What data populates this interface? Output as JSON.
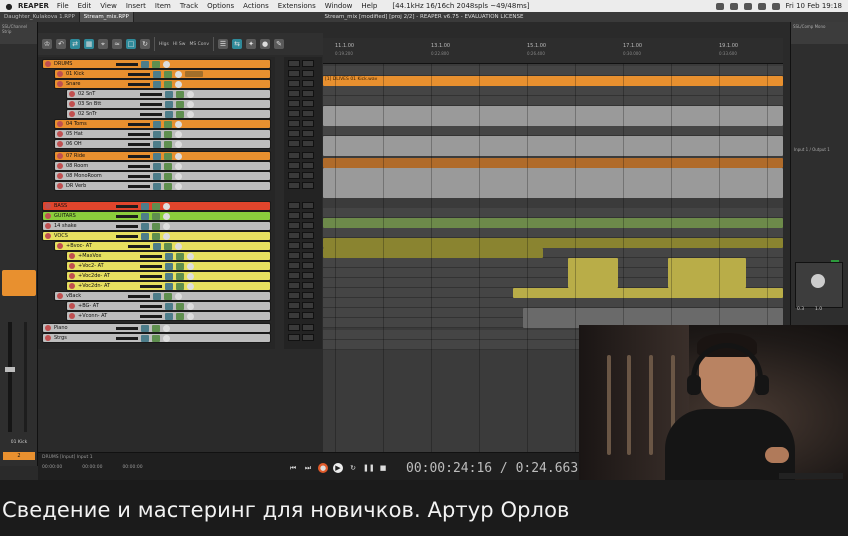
{
  "mac_menu": {
    "app": "REAPER",
    "items": [
      "File",
      "Edit",
      "View",
      "Insert",
      "Item",
      "Track",
      "Options",
      "Actions",
      "Extensions",
      "Window",
      "Help"
    ],
    "audio_info": "[44.1kHz 16/16ch 2048spls ~49/48ms]",
    "clock": "Fri 10 Feb 19:18"
  },
  "window": {
    "tabs": [
      "Daughter_Kulakova 1.RPP",
      "Stream_mix.RPP"
    ],
    "title": "Stream_mix [modified] [proj 2/2] - REAPER v6.75 - EVALUATION LICENSE"
  },
  "left_panel": {
    "header": "SSL/Channel Strip",
    "track_name": "01 Kick",
    "track_number": "2"
  },
  "toolbar": {
    "labels": [
      "Hlgs",
      "Hl Sw",
      "MS Conv"
    ]
  },
  "tracks": [
    {
      "name": "DRUMS",
      "color": "#e8902f"
    },
    {
      "name": "01 Kick",
      "color": "#e8902f"
    },
    {
      "name": "Snare",
      "color": "#e8902f"
    },
    {
      "name": "02 SnT",
      "color": "#bdbdbd"
    },
    {
      "name": "03 Sn Btt",
      "color": "#bdbdbd"
    },
    {
      "name": "02 SnTr",
      "color": "#bdbdbd"
    },
    {
      "name": "04 Toms",
      "color": "#e8902f"
    },
    {
      "name": "05 Hat",
      "color": "#bdbdbd"
    },
    {
      "name": "06 OH",
      "color": "#bdbdbd"
    },
    {
      "name": "07 Ride",
      "color": "#e8902f"
    },
    {
      "name": "08 Room",
      "color": "#bdbdbd"
    },
    {
      "name": "08 MonoRoom",
      "color": "#bdbdbd"
    },
    {
      "name": "DR Verb",
      "color": "#bdbdbd"
    },
    {
      "name": "BASS",
      "color": "#e0452c"
    },
    {
      "name": "GUITARS",
      "color": "#8bcd3c"
    },
    {
      "name": "14 shake",
      "color": "#bdbdbd"
    },
    {
      "name": "VOCS",
      "color": "#e6e060"
    },
    {
      "name": "+Bvoc- AT",
      "color": "#e6e060"
    },
    {
      "name": "+MaxVox",
      "color": "#e6e060"
    },
    {
      "name": "+Voc2- AT",
      "color": "#e6e060"
    },
    {
      "name": "+Voc2de- AT",
      "color": "#e6e060"
    },
    {
      "name": "+Voc2dn- AT",
      "color": "#e6e060"
    },
    {
      "name": "vBack",
      "color": "#bdbdbd"
    },
    {
      "name": "+BG- AT",
      "color": "#bdbdbd"
    },
    {
      "name": "+Vconn- AT",
      "color": "#bdbdbd"
    },
    {
      "name": "Piano",
      "color": "#bdbdbd"
    },
    {
      "name": "Strgs",
      "color": "#bdbdbd"
    }
  ],
  "ruler": {
    "markers": [
      "11.1.00",
      "13.1.00",
      "15.1.00",
      "17.1.00",
      "19.1.00"
    ],
    "times": [
      "0:19.200",
      "0:22.800",
      "0:26.400",
      "0:30.000",
      "0:33.600"
    ]
  },
  "arrange": {
    "item_label": "[1] DLIVES 01 Kick.wav"
  },
  "right_panel": {
    "header": "SSL/Comp Mono",
    "route": "Input 1 / Output 1",
    "values": [
      "0.3",
      "1.0"
    ]
  },
  "transport": {
    "selection": "DRUMS [Input] Input 1",
    "positions": [
      "00:00:00",
      "00:00:00",
      "00:00:00"
    ],
    "time": "00:00:24:16 / 0:24.663",
    "state": "[Stopped]"
  },
  "caption": "Сведение и мастеринг для новичков. Артур Орлов",
  "colors": {
    "accent_orange": "#e8902f",
    "accent_teal": "#2f8a9a",
    "record_red": "#e05a2a"
  }
}
